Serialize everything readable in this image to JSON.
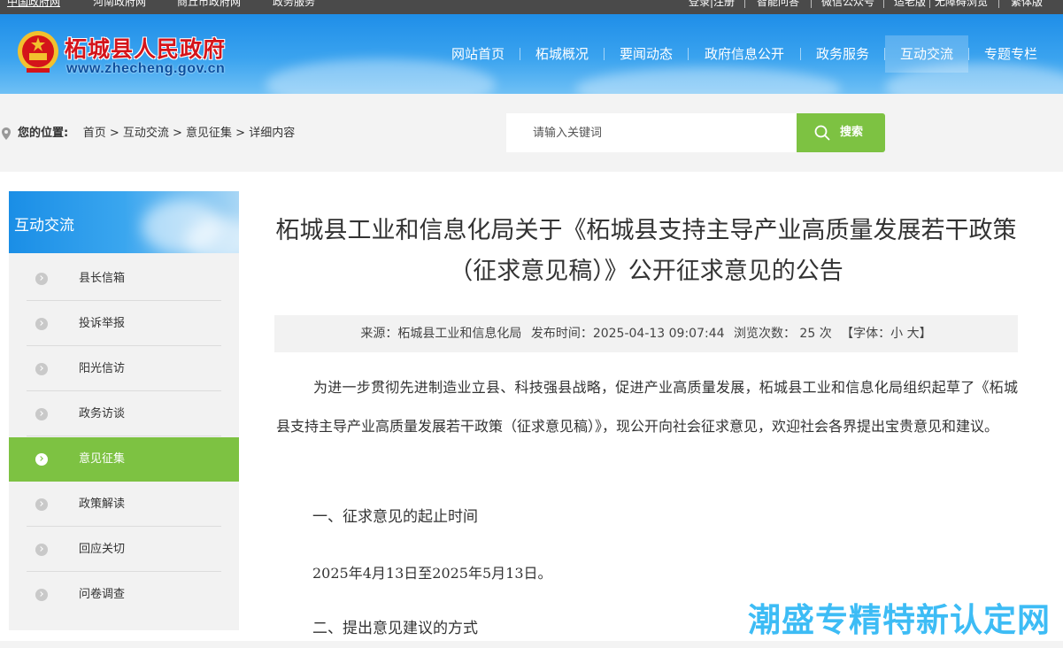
{
  "topbar": {
    "left_links": [
      "中国政府网",
      "河南政府网",
      "商丘市政府网",
      "政务服务"
    ],
    "right_links": [
      "登录|注册",
      "智能问答",
      "微信公众号",
      "适老版",
      "无障碍浏览",
      "繁体版"
    ]
  },
  "header": {
    "site_name": "柘城县人民政府",
    "site_url": "www.zhecheng.gov.cn",
    "nav": [
      "网站首页",
      "柘城概况",
      "要闻动态",
      "政府信息公开",
      "政务服务",
      "互动交流",
      "专题专栏"
    ],
    "active_nav": "互动交流"
  },
  "breadcrumb": {
    "label": "您的位置:",
    "path": "首页 > 互动交流 > 意见征集 > 详细内容"
  },
  "search": {
    "placeholder": "请输入关键词",
    "button": "搜索"
  },
  "sidebar": {
    "title": "互动交流",
    "items": [
      "县长信箱",
      "投诉举报",
      "阳光信访",
      "政务访谈",
      "意见征集",
      "政策解读",
      "回应关切",
      "问卷调查"
    ],
    "active_item": "意见征集"
  },
  "article": {
    "title": "柘城县工业和信息化局关于《柘城县支持主导产业高质量发展若干政策（征求意见稿）》公开征求意见的公告",
    "meta": {
      "source": "来源：柘城县工业和信息化局",
      "time": "发布时间：2025-04-13 09:07:44",
      "views": "浏览次数： 25  次",
      "font": "【字体：小 大】"
    },
    "para1": "为进一步贯彻先进制造业立县、科技强县战略，促进产业高质量发展，柘城县工业和信息化局组织起草了《柘城县支持主导产业高质量发展若干政策（征求意见稿）》，现公开向社会征求意见，欢迎社会各界提出宝贵意见和建议。",
    "heading1": "一、征求意见的起止时间",
    "para2": "2025年4月13日至2025年5月13日。",
    "heading2": "二、提出意见建议的方式"
  },
  "watermark": "潮盛专精特新认定网",
  "colors": {
    "header_blue": "#2a9aec",
    "accent_green": "#7dc242",
    "emblem_red": "#d4141a",
    "watermark_blue": "#2db7f5"
  }
}
